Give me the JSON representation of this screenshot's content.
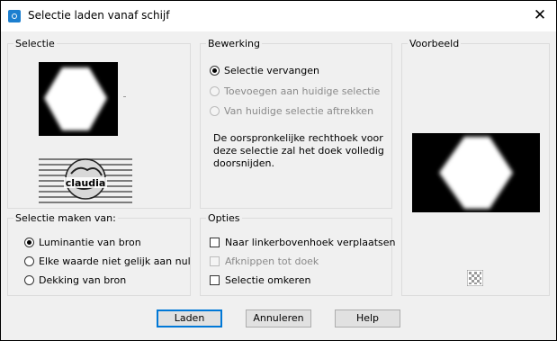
{
  "window": {
    "title": "Selectie laden vanaf schijf"
  },
  "selection_panel": {
    "label": "Selectie",
    "thumbnail_caption": "claudia"
  },
  "edit_panel": {
    "label": "Bewerking",
    "options": [
      {
        "label": "Selectie vervangen",
        "checked": true,
        "enabled": true
      },
      {
        "label": "Toevoegen aan huidige selectie",
        "checked": false,
        "enabled": false
      },
      {
        "label": "Van huidige selectie aftrekken",
        "checked": false,
        "enabled": false
      }
    ],
    "description": "De oorspronkelijke rechthoek voor deze selectie zal het doek volledig doorsnijden."
  },
  "preview_panel": {
    "label": "Voorbeeld"
  },
  "make_from_panel": {
    "label": "Selectie maken van:",
    "options": [
      {
        "label": "Luminantie van bron",
        "checked": true
      },
      {
        "label": "Elke waarde niet gelijk aan nul",
        "checked": false
      },
      {
        "label": "Dekking van bron",
        "checked": false
      }
    ]
  },
  "options_panel": {
    "label": "Opties",
    "items": [
      {
        "label": "Naar linkerbovenhoek verplaatsen",
        "checked": false,
        "enabled": true
      },
      {
        "label": "Afknippen tot doek",
        "checked": false,
        "enabled": false
      },
      {
        "label": "Selectie omkeren",
        "checked": false,
        "enabled": true
      }
    ]
  },
  "buttons": {
    "load": "Laden",
    "cancel": "Annuleren",
    "help": "Help"
  },
  "colors": {
    "accent": "#0078d7",
    "panel_bg": "#f0f0f0",
    "border": "#dcdcdc"
  }
}
